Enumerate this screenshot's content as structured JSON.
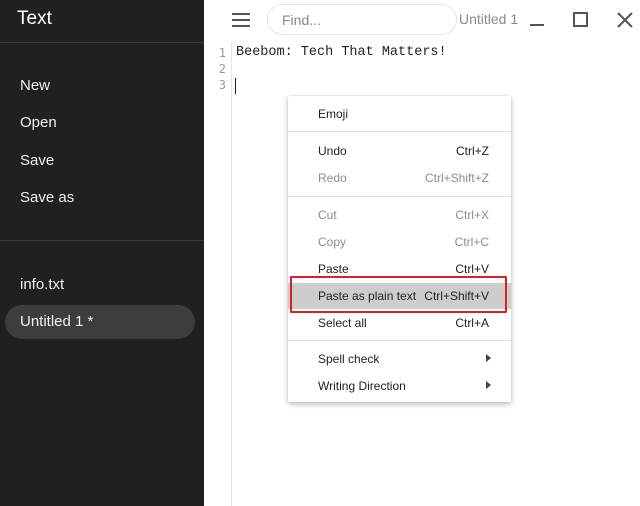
{
  "app": {
    "title": "Text"
  },
  "sidebar": {
    "actions": [
      {
        "label": "New"
      },
      {
        "label": "Open"
      },
      {
        "label": "Save"
      },
      {
        "label": "Save as"
      }
    ],
    "files": [
      {
        "label": "info.txt"
      },
      {
        "label": "Untitled 1 *",
        "active": true
      }
    ]
  },
  "topbar": {
    "search_placeholder": "Find...",
    "document_title": "Untitled 1"
  },
  "editor": {
    "line_numbers": [
      "1",
      "2",
      "3"
    ],
    "lines": [
      "Beebom: Tech That Matters!",
      "",
      ""
    ]
  },
  "context_menu": {
    "items": [
      {
        "label": "Emoji",
        "shortcut": "",
        "enabled": true
      },
      {
        "label": "Undo",
        "shortcut": "Ctrl+Z",
        "enabled": true
      },
      {
        "label": "Redo",
        "shortcut": "Ctrl+Shift+Z",
        "enabled": false
      },
      {
        "label": "Cut",
        "shortcut": "Ctrl+X",
        "enabled": false
      },
      {
        "label": "Copy",
        "shortcut": "Ctrl+C",
        "enabled": false
      },
      {
        "label": "Paste",
        "shortcut": "Ctrl+V",
        "enabled": true
      },
      {
        "label": "Paste as plain text",
        "shortcut": "Ctrl+Shift+V",
        "enabled": true,
        "highlighted": true
      },
      {
        "label": "Select all",
        "shortcut": "Ctrl+A",
        "enabled": true
      },
      {
        "label": "Spell check",
        "shortcut": "",
        "enabled": true,
        "submenu": true
      },
      {
        "label": "Writing Direction",
        "shortcut": "",
        "enabled": true,
        "submenu": true
      }
    ]
  },
  "colors": {
    "sidebar_bg": "#202020",
    "active_file_bg": "#3d3d3d",
    "highlight_row": "#cdcdcd",
    "annotation_box": "#e02020"
  }
}
